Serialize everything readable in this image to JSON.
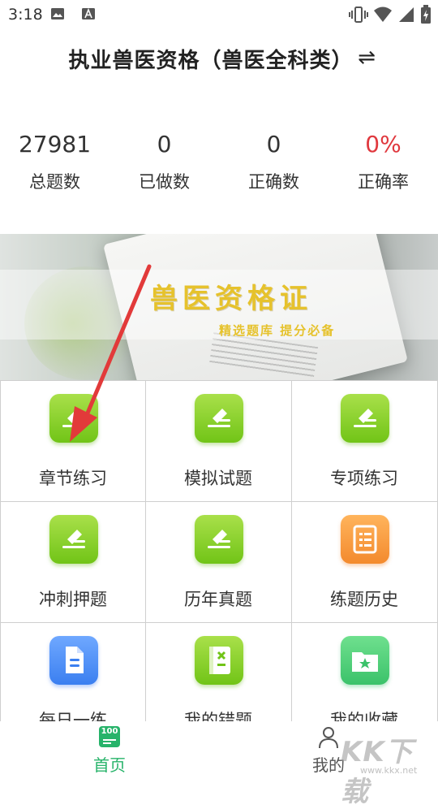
{
  "status_bar": {
    "time": "3:18"
  },
  "header": {
    "title": "执业兽医资格（兽医全科类）",
    "switch_icon": "⇌"
  },
  "stats": [
    {
      "value": "27981",
      "label": "总题数"
    },
    {
      "value": "0",
      "label": "已做数"
    },
    {
      "value": "0",
      "label": "正确数"
    },
    {
      "value": "0%",
      "label": "正确率"
    }
  ],
  "banner": {
    "title": "兽医资格证",
    "subtitle": "精选题库  提分必备"
  },
  "menu": [
    {
      "label": "章节练习",
      "icon": "edit-icon"
    },
    {
      "label": "模拟试题",
      "icon": "edit-icon"
    },
    {
      "label": "专项练习",
      "icon": "edit-icon"
    },
    {
      "label": "冲刺押题",
      "icon": "edit-icon"
    },
    {
      "label": "历年真题",
      "icon": "edit-icon"
    },
    {
      "label": "练题历史",
      "icon": "notebook-icon"
    },
    {
      "label": "每日一练",
      "icon": "document-icon"
    },
    {
      "label": "我的错题",
      "icon": "wrong-book-icon"
    },
    {
      "label": "我的收藏",
      "icon": "star-folder-icon"
    }
  ],
  "bottom_nav": {
    "home_badge": "100",
    "home_label": "首页",
    "me_label": "我的"
  },
  "watermark": {
    "text": "KK下载",
    "sub": "www.kkx.net"
  },
  "colors": {
    "accent": "#27b36a",
    "red": "#e0383e",
    "banner_gold": "#e6c22c"
  }
}
